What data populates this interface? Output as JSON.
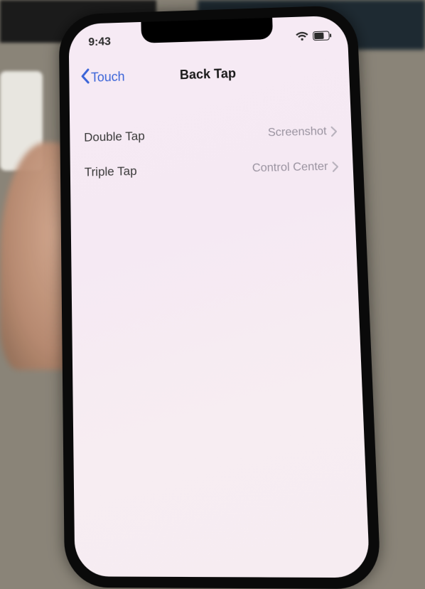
{
  "status": {
    "time": "9:43"
  },
  "nav": {
    "back_label": "Touch",
    "title": "Back Tap"
  },
  "rows": {
    "double": {
      "label": "Double Tap",
      "value": "Screenshot"
    },
    "triple": {
      "label": "Triple Tap",
      "value": "Control Center"
    }
  }
}
